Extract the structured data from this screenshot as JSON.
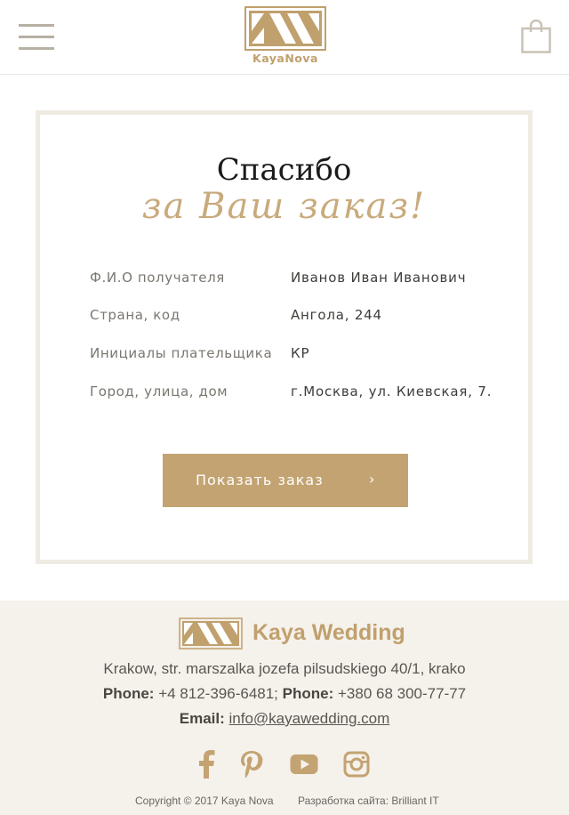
{
  "header": {
    "logo_text": "KayaNova",
    "menu_icon": "hamburger-menu-icon",
    "cart_icon": "shopping-bag-icon"
  },
  "thanks": {
    "title": "Спасибо",
    "subtitle": "за Ваш заказ!"
  },
  "order_info": [
    {
      "label": "Ф.И.О получателя",
      "value": "Иванов Иван Иванович"
    },
    {
      "label": "Страна, код",
      "value": "Ангола, 244"
    },
    {
      "label": "Инициалы плательщика",
      "value": "КР"
    },
    {
      "label": "Город, улица, дом",
      "value": "г.Москва, ул. Киевская, 7."
    }
  ],
  "show_order_button": {
    "label": "Показать заказ",
    "arrow": "›"
  },
  "footer": {
    "brand": "Kaya Wedding",
    "address": "Krakow, str. marszalka jozefa pilsudskiego 40/1, krako",
    "phone_label_1": "Phone:",
    "phone_1": "+4 812-396-6481;",
    "phone_label_2": "Phone:",
    "phone_2": "+380 68 300-77-77",
    "email_label": "Email:",
    "email": "info@kayawedding.com",
    "social": [
      "facebook-icon",
      "pinterest-icon",
      "youtube-icon",
      "instagram-icon"
    ],
    "copyright": "Copyright © 2017 Kaya Nova",
    "developer": "Разработка сайта: Brilliant IT"
  },
  "colors": {
    "accent": "#c3a371",
    "card_border": "#efebe3",
    "footer_bg": "#f5f1eb",
    "icon_gray": "#b7b0a4"
  }
}
